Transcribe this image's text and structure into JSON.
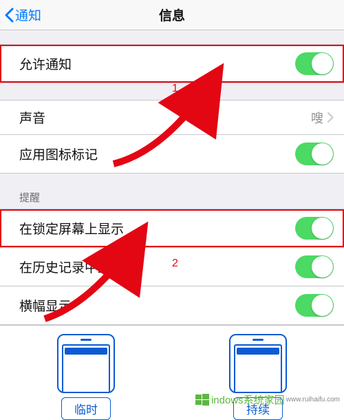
{
  "nav": {
    "back_label": "通知",
    "title": "信息"
  },
  "group1": {
    "allow_label": "允许通知"
  },
  "group2": {
    "sound_label": "声音",
    "sound_value": "嗖",
    "badge_label": "应用图标标记"
  },
  "group3": {
    "header": "提醒",
    "lock_label": "在锁定屏幕上显示",
    "history_label": "在历史记录中显示",
    "banner_label": "横幅显示"
  },
  "previews": {
    "left_label": "临时",
    "right_label": "持续"
  },
  "annotation": {
    "num1": "1",
    "num2": "2"
  },
  "watermark": {
    "brand": "indows系统家园",
    "url": "www.ruihaifu.com"
  },
  "colors": {
    "accent_blue": "#007aff",
    "toggle_green": "#4cd964",
    "annotation_red": "#e30613",
    "preview_blue": "#0a5bd3"
  }
}
